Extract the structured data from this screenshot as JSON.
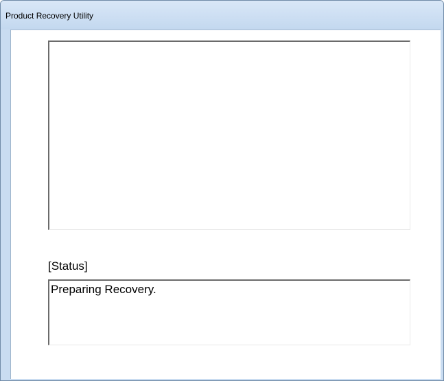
{
  "window": {
    "title": "Product Recovery Utility"
  },
  "log": {
    "text": ""
  },
  "status": {
    "label": "[Status]",
    "text": "Preparing Recovery."
  }
}
